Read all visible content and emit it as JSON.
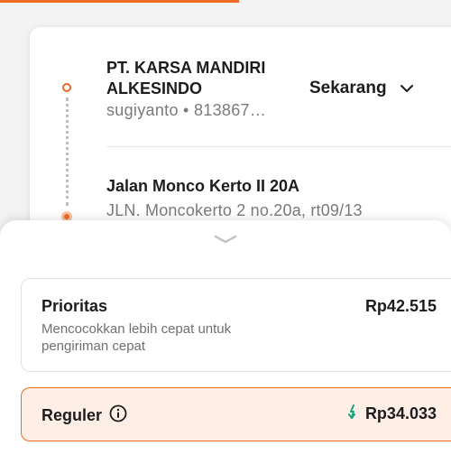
{
  "origin": {
    "name": "PT. KARSA MANDIRI ALKESINDO",
    "contact": "sugiyanto • 813867…"
  },
  "schedule": {
    "value": "Sekarang"
  },
  "destination": {
    "name": "Jalan Monco Kerto II 20A",
    "detail": "JLN. Moncokerto 2 no.20a, rt09/13"
  },
  "options": {
    "prioritas": {
      "title": "Prioritas",
      "description": "Mencocokkan lebih cepat untuk pengiriman cepat",
      "price": "Rp42.515"
    },
    "reguler": {
      "title": "Reguler",
      "price": "Rp34.033"
    }
  },
  "colors": {
    "accent": "#ee6a26",
    "discount": "#1aa37a"
  },
  "icons": {
    "schedule": "chevron-down-icon",
    "sheet": "sheet-handle-icon",
    "reguler_info": "info-icon",
    "price_drop": "price-drop-arrow-icon"
  }
}
